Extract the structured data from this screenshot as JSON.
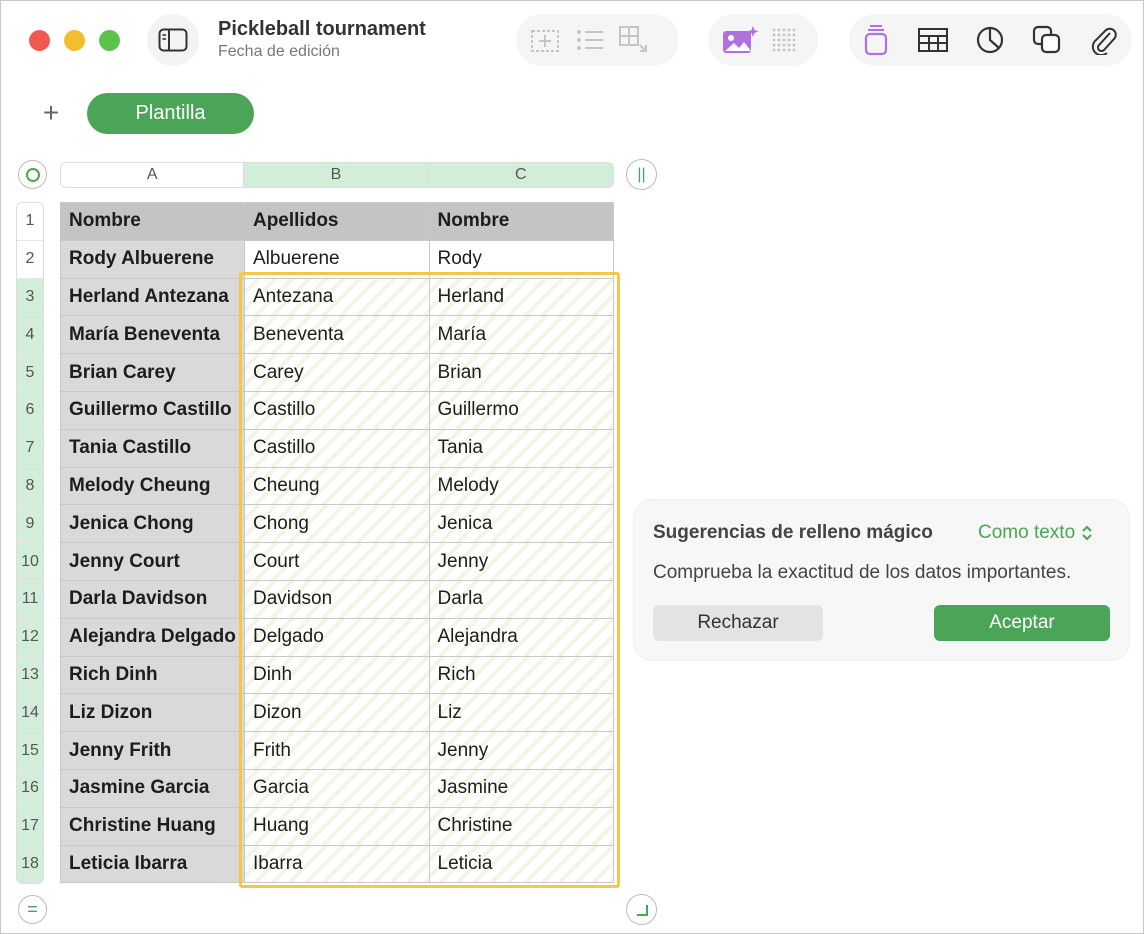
{
  "window": {
    "title": "Pickleball tournament",
    "subtitle": "Fecha de edición"
  },
  "toolbar": {
    "icons": [
      "sidebar-icon",
      "insert-text-box-icon",
      "list-icon",
      "add-table-icon",
      "insert-image-magic-icon",
      "dots-grid-icon",
      "document-icon",
      "table-icon",
      "chart-icon",
      "shapes-icon",
      "attachment-icon"
    ],
    "accent_color": "#b070e0"
  },
  "sheet": {
    "add_label": "+",
    "tab_label": "Plantilla",
    "tab_color": "#4aa556"
  },
  "columns": [
    "A",
    "B",
    "C"
  ],
  "rows": [
    {
      "num": "1",
      "cells": [
        "Nombre",
        "Apellidos",
        "Nombre"
      ]
    },
    {
      "num": "2",
      "cells": [
        "Rody Albuerene",
        "Albuerene",
        "Rody"
      ]
    },
    {
      "num": "3",
      "cells": [
        "Herland Antezana",
        "Antezana",
        "Herland"
      ]
    },
    {
      "num": "4",
      "cells": [
        "María Beneventa",
        "Beneventa",
        "María"
      ]
    },
    {
      "num": "5",
      "cells": [
        "Brian Carey",
        "Carey",
        "Brian"
      ]
    },
    {
      "num": "6",
      "cells": [
        "Guillermo Castillo",
        "Castillo",
        "Guillermo"
      ]
    },
    {
      "num": "7",
      "cells": [
        "Tania Castillo",
        "Castillo",
        "Tania"
      ]
    },
    {
      "num": "8",
      "cells": [
        "Melody Cheung",
        "Cheung",
        "Melody"
      ]
    },
    {
      "num": "9",
      "cells": [
        "Jenica Chong",
        "Chong",
        "Jenica"
      ]
    },
    {
      "num": "10",
      "cells": [
        "Jenny Court",
        "Court",
        "Jenny"
      ]
    },
    {
      "num": "11",
      "cells": [
        "Darla Davidson",
        "Davidson",
        "Darla"
      ]
    },
    {
      "num": "12",
      "cells": [
        "Alejandra Delgado",
        "Delgado",
        "Alejandra"
      ]
    },
    {
      "num": "13",
      "cells": [
        "Rich Dinh",
        "Dinh",
        "Rich"
      ]
    },
    {
      "num": "14",
      "cells": [
        "Liz Dizon",
        "Dizon",
        "Liz"
      ]
    },
    {
      "num": "15",
      "cells": [
        "Jenny Frith",
        "Frith",
        "Jenny"
      ]
    },
    {
      "num": "16",
      "cells": [
        "Jasmine Garcia",
        "Garcia",
        "Jasmine"
      ]
    },
    {
      "num": "17",
      "cells": [
        "Christine Huang",
        "Huang",
        "Christine"
      ]
    },
    {
      "num": "18",
      "cells": [
        "Leticia Ibarra",
        "Ibarra",
        "Leticia"
      ]
    }
  ],
  "popover": {
    "title": "Sugerencias de relleno mágico",
    "mode": "Como texto",
    "message": "Comprueba la exactitud de los datos importantes.",
    "reject_label": "Rechazar",
    "accept_label": "Aceptar",
    "selection_color": "#f4c842"
  }
}
